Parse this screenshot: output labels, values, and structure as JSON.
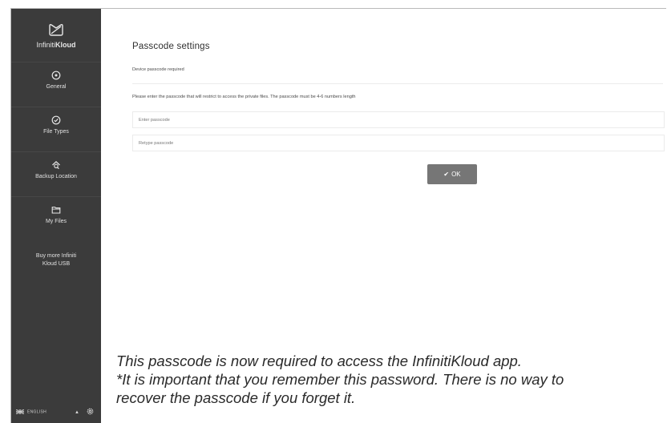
{
  "app": {
    "brand_prefix": "Infiniti",
    "brand_suffix": "Kloud"
  },
  "sidebar": {
    "items": [
      {
        "label": "General",
        "icon": "general-icon"
      },
      {
        "label": "File Types",
        "icon": "check-circle-icon"
      },
      {
        "label": "Backup Location",
        "icon": "backup-home-icon"
      },
      {
        "label": "My Files",
        "icon": "folder-icon"
      }
    ],
    "buy_line1": "Buy more Infiniti",
    "buy_line2": "Kloud USB",
    "language": "ENGLISH",
    "language_caret": "▲"
  },
  "main": {
    "title": "Passcode settings",
    "subtitle": "Device passcode required",
    "description": "Please enter the passcode that will restrict to access the private files. The passcode must be 4-6 numbers length",
    "passcode_placeholder": "Enter passcode",
    "retype_placeholder": "Retype passcode",
    "ok_label": "OK"
  },
  "caption": {
    "line1": "This passcode is now required to access the InfinitiKloud app.",
    "line2": "*It is important that you remember this password. There is no way to",
    "line3": "recover the passcode if you forget it."
  },
  "colors": {
    "sidebar_bg": "#3b3b3b",
    "button_bg": "#767676"
  }
}
